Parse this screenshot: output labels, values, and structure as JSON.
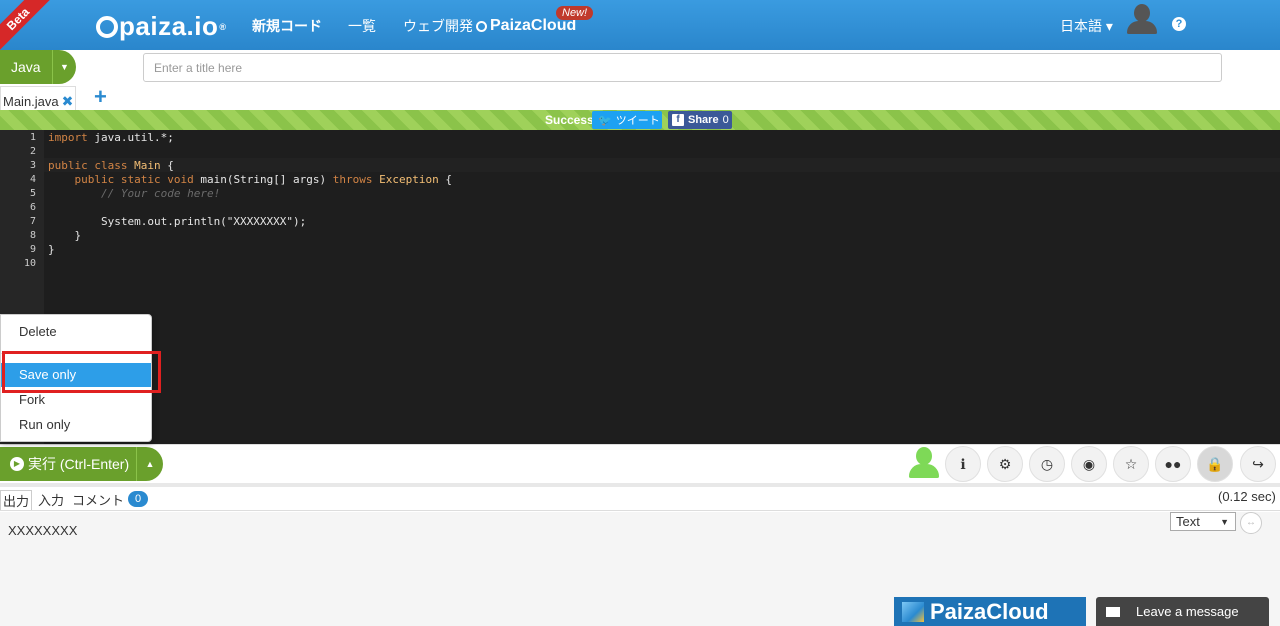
{
  "header": {
    "beta": "Beta",
    "logo_text": "paiza.io",
    "logo_reg": "®",
    "nav_new_code": "新規コード",
    "nav_list": "一覧",
    "nav_web_dev": "ウェブ開発",
    "nav_paizacloud": "PaizaCloud",
    "new_badge": "New!",
    "language_menu": "日本語 ▾",
    "help": "?"
  },
  "editor_bar": {
    "language": "Java",
    "title_placeholder": "Enter a title here",
    "file_tab": "Main.java",
    "file_close": "✖",
    "add_file": "+"
  },
  "status": {
    "success": "Success",
    "tweet": "ツイート",
    "share": "Share",
    "share_count": "0"
  },
  "code": {
    "line_numbers": [
      "1",
      "2",
      "3",
      "4",
      "5",
      "6",
      "7",
      "8",
      "9",
      "10"
    ]
  },
  "context_menu": {
    "items": [
      "Delete",
      "Save only",
      "Fork",
      "Run only"
    ]
  },
  "run": {
    "label": "実行 (Ctrl-Enter)"
  },
  "output": {
    "tabs": [
      "出力",
      "入力",
      "コメント"
    ],
    "comment_count": "0",
    "time": "(0.12 sec)",
    "text": "XXXXXXXX",
    "format": "Text"
  },
  "footer": {
    "paizacloud": "PaizaCloud",
    "leave_message": "Leave a message"
  },
  "colors": {
    "header_blue": "#2e8fd6",
    "run_green": "#6aa02c",
    "success_green": "#8bc34a",
    "editor_bg": "#1e1e1e",
    "menu_selected": "#2d9ee8",
    "highlight_red": "#e02020"
  }
}
